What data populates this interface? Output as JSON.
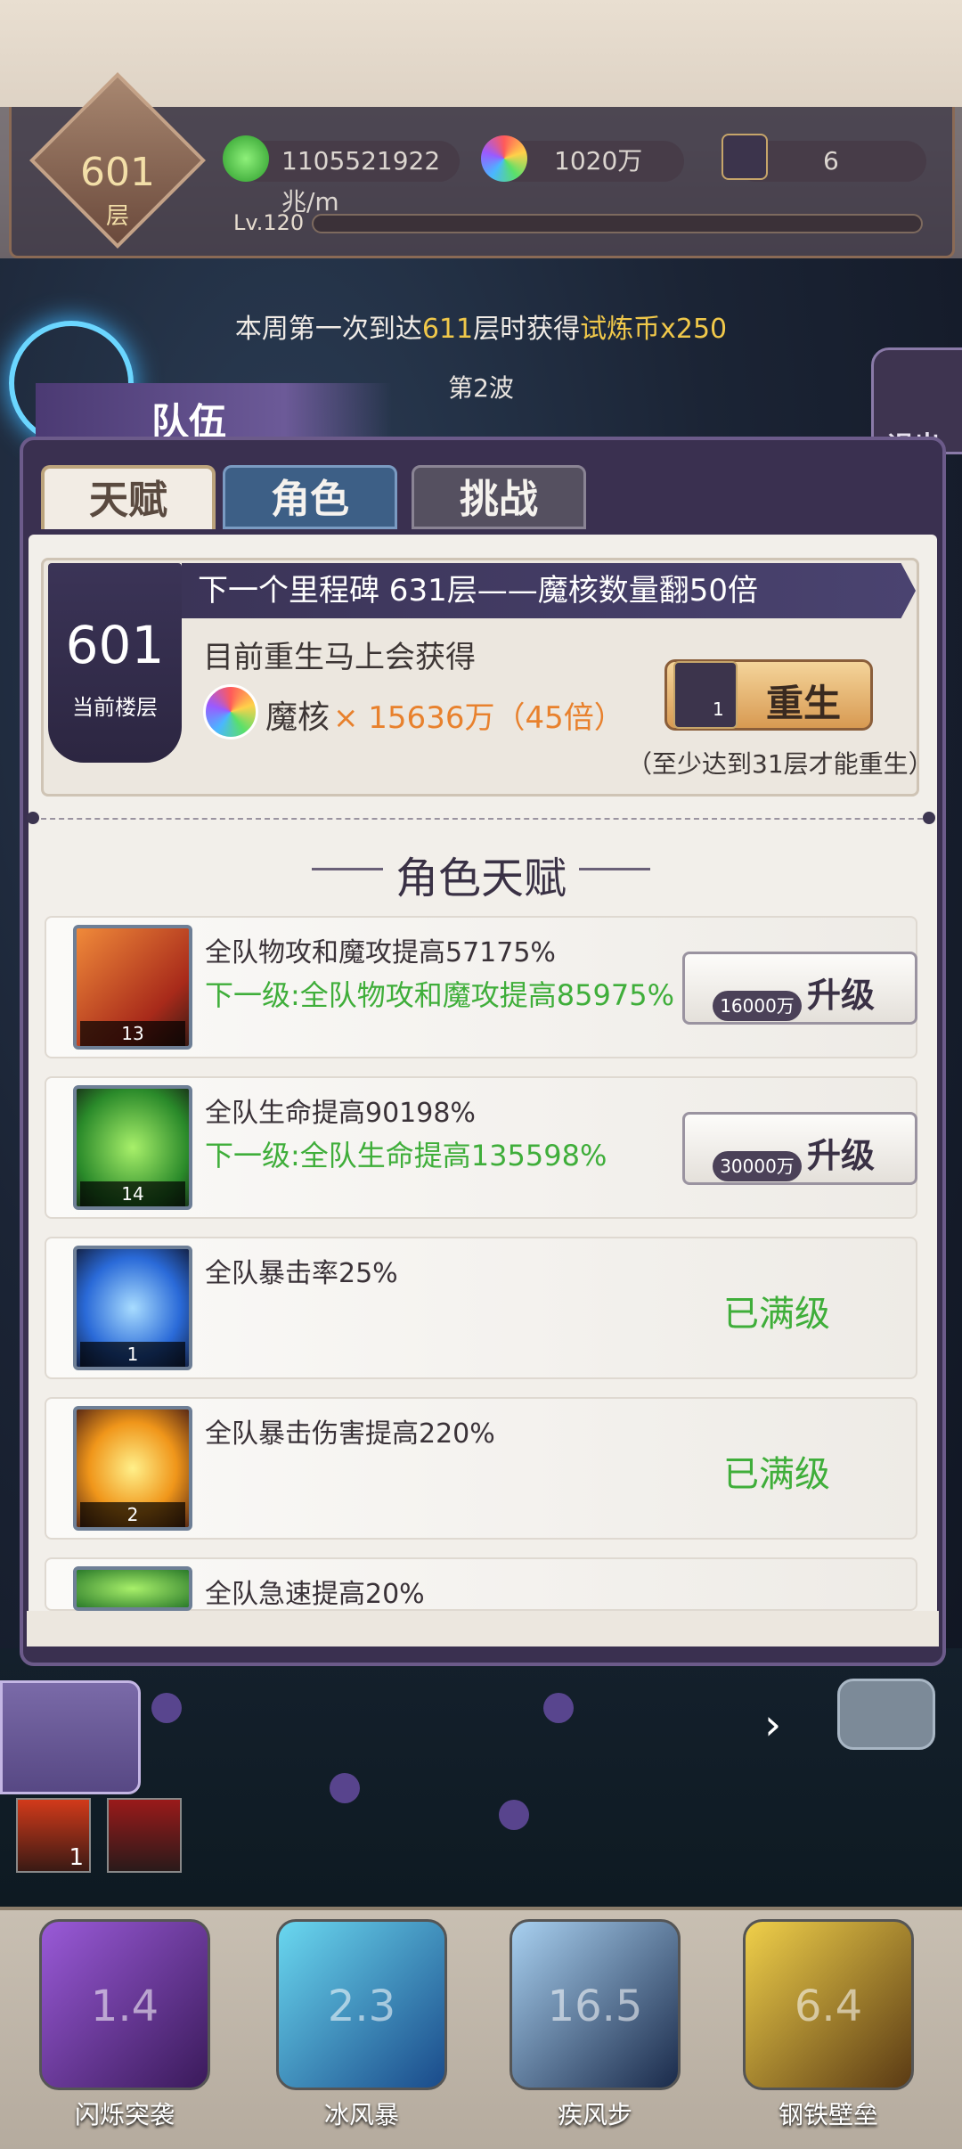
{
  "hud": {
    "floor_number": "601",
    "floor_unit": "层",
    "exp_value": "1105521922兆/m",
    "core_value": "1020万",
    "book_count": "6",
    "level": "Lv.120"
  },
  "notice": {
    "prefix": "本周第一次到达",
    "floor": "611",
    "mid": "层时获得",
    "reward": "试炼币x250"
  },
  "wave": "第2波",
  "team_label": "队伍",
  "exit_label": "退出",
  "tabs": [
    {
      "label": "天赋",
      "active": true
    },
    {
      "label": "角色",
      "active": false
    },
    {
      "label": "挑战",
      "active": false
    }
  ],
  "milestone": {
    "floor_number": "601",
    "floor_label": "当前楼层",
    "banner": "下一个里程碑 631层——魔核数量翻50倍",
    "rebirth_gain_label": "目前重生马上会获得",
    "core_name": "魔核",
    "core_amount": "× 15636万（45倍）",
    "rebirth_button": "重生",
    "rebirth_badge": "1",
    "rebirth_note": "（至少达到31层才能重生）"
  },
  "section_title": "角色天赋",
  "talents": [
    {
      "icon": "sword-icon",
      "level": "13",
      "desc": "全队物攻和魔攻提高57175%",
      "next": "下一级:全队物攻和魔攻提高85975%",
      "cost": "16000万",
      "action": "升级",
      "maxed": ""
    },
    {
      "icon": "winged-egg-icon",
      "level": "14",
      "desc": "全队生命提高90198%",
      "next": "下一级:全队生命提高135598%",
      "cost": "30000万",
      "action": "升级",
      "maxed": ""
    },
    {
      "icon": "star-orb-icon",
      "level": "1",
      "desc": "全队暴击率25%",
      "next": "",
      "cost": "",
      "action": "",
      "maxed": "已满级"
    },
    {
      "icon": "burst-icon",
      "level": "2",
      "desc": "全队暴击伤害提高220%",
      "next": "",
      "cost": "",
      "action": "",
      "maxed": "已满级"
    },
    {
      "icon": "speed-icon",
      "level": "",
      "desc": "全队急速提高20%",
      "next": "",
      "cost": "",
      "action": "",
      "maxed": ""
    }
  ],
  "buffs": [
    {
      "icon": "fire-buff-icon",
      "count": "1"
    },
    {
      "icon": "sword-cross-buff-icon",
      "count": ""
    }
  ],
  "skills": [
    {
      "name": "闪烁突袭",
      "cooldown": "1.4",
      "icon": "blink-strike-icon",
      "color": "#6a3aa8"
    },
    {
      "name": "冰风暴",
      "cooldown": "2.3",
      "icon": "ice-storm-icon",
      "color": "#2a7ab8"
    },
    {
      "name": "疾风步",
      "cooldown": "16.5",
      "icon": "wind-step-icon",
      "color": "#3a5a8a"
    },
    {
      "name": "钢铁壁垒",
      "cooldown": "6.4",
      "icon": "iron-wall-icon",
      "color": "#b8841a"
    }
  ]
}
